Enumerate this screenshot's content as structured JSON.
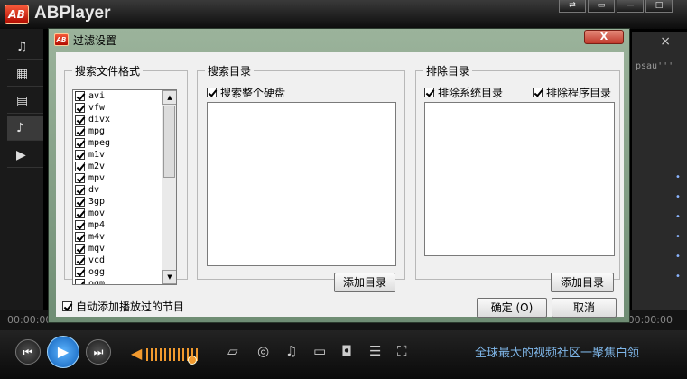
{
  "app": {
    "logo_text": "AB",
    "title": "ABPlayer",
    "window_buttons": [
      "⇄",
      "▭",
      "—",
      "□"
    ]
  },
  "sidebar": {
    "icons": [
      "music-icon",
      "film-icon",
      "subtitle-icon",
      "playlist-music-icon",
      "play-icon"
    ]
  },
  "right_panel": {
    "close": "×",
    "snippet": "psau'''"
  },
  "timeline": {
    "elapsed": "00:00:00",
    "total": "00:00:00"
  },
  "controls": {
    "prev": "⏮",
    "play": "▶",
    "next": "⏭",
    "volume_icon": "speaker-icon",
    "tools": [
      "folder-icon",
      "disc-icon",
      "music-note-icon",
      "subtitle-icon",
      "camera-icon",
      "list-icon",
      "fullscreen-icon"
    ],
    "slogan": "全球最大的视频社区一聚焦白领"
  },
  "dialog": {
    "logo_text": "AB",
    "title": "过滤设置",
    "close": "X",
    "formats": {
      "legend": "搜索文件格式",
      "items": [
        {
          "label": "avi",
          "checked": true
        },
        {
          "label": "vfw",
          "checked": true
        },
        {
          "label": "divx",
          "checked": true
        },
        {
          "label": "mpg",
          "checked": true
        },
        {
          "label": "mpeg",
          "checked": true
        },
        {
          "label": "m1v",
          "checked": true
        },
        {
          "label": "m2v",
          "checked": true
        },
        {
          "label": "mpv",
          "checked": true
        },
        {
          "label": "dv",
          "checked": true
        },
        {
          "label": "3gp",
          "checked": true
        },
        {
          "label": "mov",
          "checked": true
        },
        {
          "label": "mp4",
          "checked": true
        },
        {
          "label": "m4v",
          "checked": true
        },
        {
          "label": "mqv",
          "checked": true
        },
        {
          "label": "vcd",
          "checked": true
        },
        {
          "label": "ogg",
          "checked": true
        },
        {
          "label": "ogm",
          "checked": true
        }
      ]
    },
    "search_dir": {
      "legend": "搜索目录",
      "search_all_disks": "搜索整个硬盘",
      "search_all_checked": true,
      "add_button": "添加目录"
    },
    "exclude_dir": {
      "legend": "排除目录",
      "exclude_system": "排除系统目录",
      "exclude_system_checked": true,
      "exclude_program": "排除程序目录",
      "exclude_program_checked": true,
      "add_button": "添加目录"
    },
    "auto_add": {
      "label": "自动添加播放过的节目",
      "checked": true
    },
    "ok_button": "确定 (O)",
    "cancel_button": "取消"
  }
}
